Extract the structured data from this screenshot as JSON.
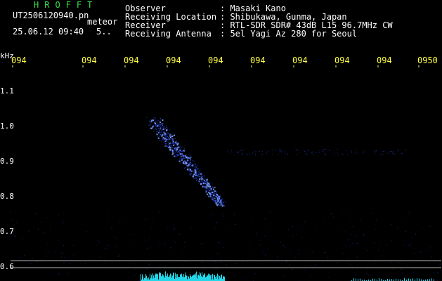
{
  "header": {
    "brand": "HROFFT",
    "filename": "UT2506120940.pn",
    "event_type": "meteor",
    "datetime": "25.06.12 09:40",
    "misc": "5..",
    "fields": [
      {
        "label": "Observer",
        "value": ": Masaki Kano"
      },
      {
        "label": "Receiving Location",
        "value": ": Shibukawa, Gunma, Japan"
      },
      {
        "label": "Receiver",
        "value": ": RTL-SDR SDR# 43dB L15 96.7MHz CW"
      },
      {
        "label": "Receiving Antenna",
        "value": ": 5el Yagi Az 280 for Seoul"
      }
    ]
  },
  "colors": {
    "background": "#000000",
    "time_ticks": "#ffff4a",
    "brand": "#36e04a",
    "echo": "#2f4cff",
    "echo_bright": "#7ea4ff",
    "spectrum": "#22d6e8",
    "baseline": "#b8b8b8"
  },
  "chart_data": {
    "type": "heatmap",
    "xlabel": "",
    "ylabel": "kHz",
    "x_ticks": [
      "094",
      "094",
      "094",
      "094",
      "094",
      "094",
      "094",
      "094",
      "094",
      "0950"
    ],
    "y_ticks": [
      "1.1",
      "1.0",
      "0.9",
      "0.8",
      "0.7",
      "0.6"
    ],
    "ylim": [
      0.58,
      1.16
    ],
    "echo": {
      "start_freq_khz": 1.02,
      "end_freq_khz": 0.78,
      "time_span_fraction": [
        0.33,
        0.49
      ]
    },
    "reference_lines_khz": [
      0.62,
      0.6
    ]
  }
}
